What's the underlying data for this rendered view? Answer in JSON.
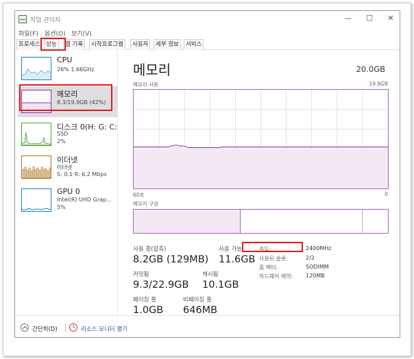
{
  "window": {
    "title": "작업 관리자",
    "controls": {
      "minimize": "—",
      "maximize": "☐",
      "close": "✕"
    }
  },
  "menu": [
    "파일(F)",
    "옵션(O)",
    "보기(V)"
  ],
  "tabs": [
    {
      "label": "프로세스",
      "active": false
    },
    {
      "label": "성능",
      "active": true
    },
    {
      "label": "앱 기록",
      "active": false
    },
    {
      "label": "시작프로그램",
      "active": false
    },
    {
      "label": "사용자",
      "active": false
    },
    {
      "label": "세부 정보",
      "active": false
    },
    {
      "label": "서비스",
      "active": false
    }
  ],
  "sidebar": {
    "items": [
      {
        "title": "CPU",
        "line1": "26%  1.66GHz",
        "line2": "",
        "color": "#1c7fc4"
      },
      {
        "title": "메모리",
        "line1": "8.3/19.9GB (42%)",
        "line2": "",
        "color": "#8b2da8"
      },
      {
        "title": "디스크 0(H: G: C:",
        "line1": "SSD",
        "line2": "2%",
        "color": "#4c9a2a"
      },
      {
        "title": "이더넷",
        "line1": "이더넷",
        "line2": "S: 0.1  R: 6.2 Mbps",
        "color": "#a87420"
      },
      {
        "title": "GPU 0",
        "line1": "Intel(R) UHD Grap...",
        "line2": "5%",
        "color": "#1c7fc4"
      }
    ]
  },
  "main": {
    "title": "메모리",
    "capacity": "20.0GB",
    "usage_label": "메모리 사용",
    "usage_max": "19.9GB",
    "axis_left": "60초",
    "axis_right": "0",
    "composition_label": "메모리 구성",
    "usage_fraction": 0.42,
    "stats": {
      "in_use_label": "사용 중(압축)",
      "in_use_value": "8.2GB (129MB)",
      "available_label": "사용 가능",
      "available_value": "11.6GB",
      "committed_label": "커밋됨",
      "committed_value": "9.3/22.9GB",
      "cached_label": "캐시됨",
      "cached_value": "10.1GB",
      "paged_label": "페이징 풀",
      "paged_value": "1.0GB",
      "nonpaged_label": "비페이징 풀",
      "nonpaged_value": "646MB"
    },
    "details": {
      "speed_label": "속도:",
      "speed_value": "2400MHz",
      "slots_label": "사용된 슬롯:",
      "slots_value": "2/2",
      "form_label": "폼 팩터:",
      "form_value": "SODIMM",
      "reserved_label": "하드웨어 예약:",
      "reserved_value": "120MB"
    }
  },
  "footer": {
    "fewer_details": "간단히(D)",
    "resource_monitor": "리소스 모니터 열기"
  },
  "colors": {
    "accent": "#8b2da8",
    "graph_fill": "#f3e9f5",
    "annotation": "#e01a1a",
    "link": "#1a5fb4"
  }
}
